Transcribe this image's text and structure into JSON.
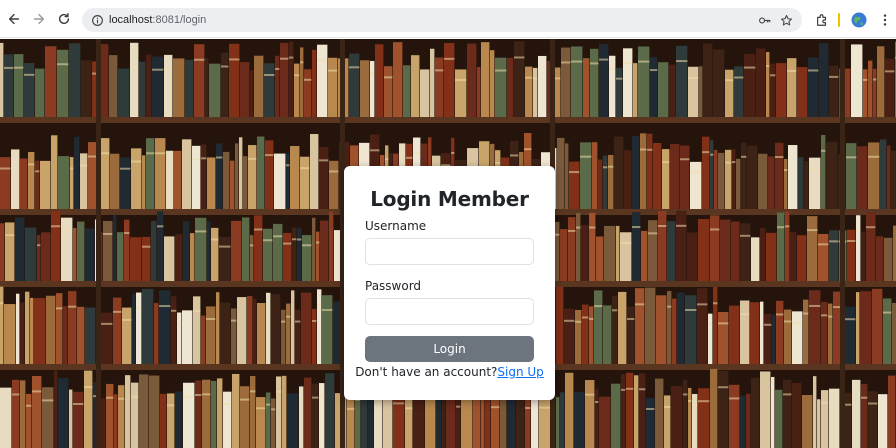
{
  "browser": {
    "url_host": "localhost",
    "url_path": ":8081/login",
    "icons": [
      "back-arrow-icon",
      "forward-arrow-icon",
      "reload-icon",
      "site-info-icon",
      "password-key-icon",
      "bookmark-star-icon",
      "extensions-icon",
      "profile-avatar-icon",
      "menu-dots-icon"
    ]
  },
  "page": {
    "background": "bookshelf-photo",
    "colors": {
      "card_bg": "#ffffff",
      "button_bg": "#6c757d",
      "link": "#0d6efd"
    }
  },
  "login": {
    "title": "Login Member",
    "username_label": "Username",
    "username_value": "",
    "password_label": "Password",
    "password_value": "",
    "submit_label": "Login",
    "signup_prompt": "Don't have an account?",
    "signup_link": "Sign Up"
  }
}
